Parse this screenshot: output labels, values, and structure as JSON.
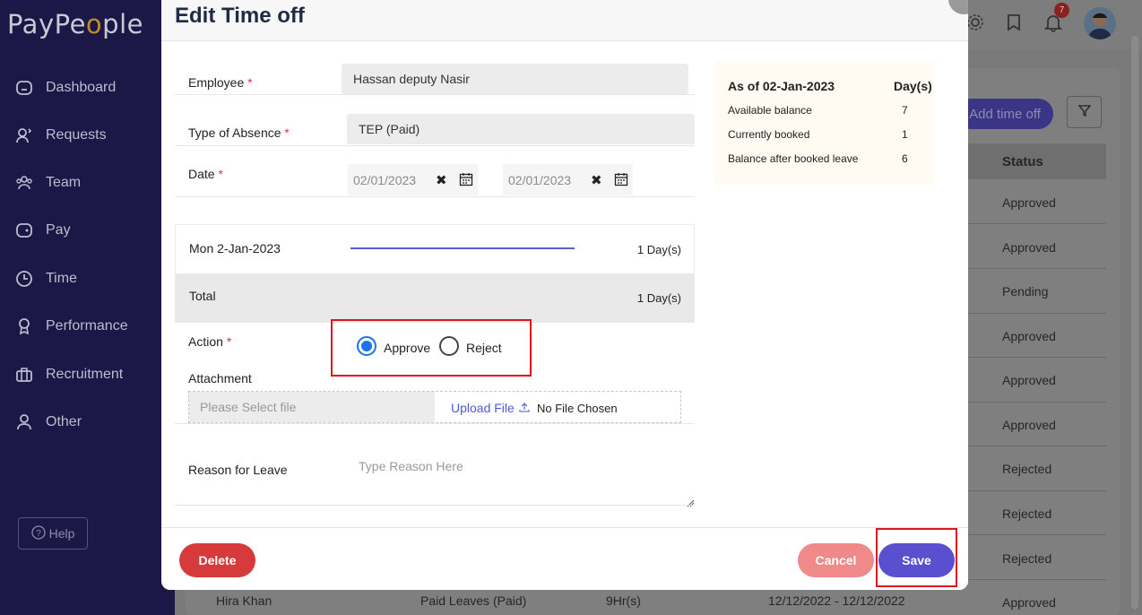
{
  "app": {
    "logo_text_a": "PayPe",
    "logo_text_b": "o",
    "logo_text_c": "ple"
  },
  "sidebar": {
    "items": [
      {
        "label": "Dashboard",
        "icon": "home-icon"
      },
      {
        "label": "Requests",
        "icon": "requests-icon"
      },
      {
        "label": "Team",
        "icon": "team-icon"
      },
      {
        "label": "Pay",
        "icon": "wallet-icon"
      },
      {
        "label": "Time",
        "icon": "clock-icon"
      },
      {
        "label": "Performance",
        "icon": "award-icon"
      },
      {
        "label": "Recruitment",
        "icon": "briefcase-icon"
      },
      {
        "label": "Other",
        "icon": "user-icon"
      }
    ],
    "help": "Help"
  },
  "header": {
    "notification_count": "7"
  },
  "background": {
    "add_button": "Add time off",
    "status_header": "Status",
    "statuses": [
      "Approved",
      "Approved",
      "Pending",
      "Approved",
      "Approved",
      "Approved",
      "Rejected",
      "Rejected",
      "Rejected",
      "Approved"
    ],
    "last_row": {
      "name": "Hira Khan",
      "type": "Paid Leaves (Paid)",
      "hours": "9Hr(s)",
      "dates": "12/12/2022 - 12/12/2022"
    }
  },
  "modal": {
    "title": "Edit Time off",
    "employee_label": "Employee",
    "employee_value": "Hassan deputy Nasir",
    "absence_label": "Type of Absence",
    "absence_value": "TEP (Paid)",
    "date_label": "Date",
    "required_mark": "*",
    "date_from": "02/01/2023",
    "date_to": "02/01/2023",
    "day_row": {
      "day": "Mon 2-Jan-2023",
      "amount": "1 Day(s)"
    },
    "total_row": {
      "label": "Total",
      "amount": "1 Day(s)"
    },
    "balance": {
      "heading": "As of 02-Jan-2023",
      "unit": "Day(s)",
      "rows": [
        {
          "label": "Available balance",
          "value": "7"
        },
        {
          "label": "Currently booked",
          "value": "1"
        },
        {
          "label": "Balance after booked leave",
          "value": "6"
        }
      ]
    },
    "action_label": "Action",
    "approve": "Approve",
    "reject": "Reject",
    "attachment_label": "Attachment",
    "file_placeholder": "Please Select file",
    "upload": "Upload File",
    "no_file": "No File Chosen",
    "reason_label": "Reason for Leave",
    "reason_placeholder": "Type Reason Here",
    "delete": "Delete",
    "cancel": "Cancel",
    "save": "Save"
  },
  "colors": {
    "sidebar": "#1b1747",
    "accent": "#5a4fcf",
    "delete": "#d63a3a",
    "cancel": "#f08a8a",
    "highlight": "#e0141c"
  }
}
